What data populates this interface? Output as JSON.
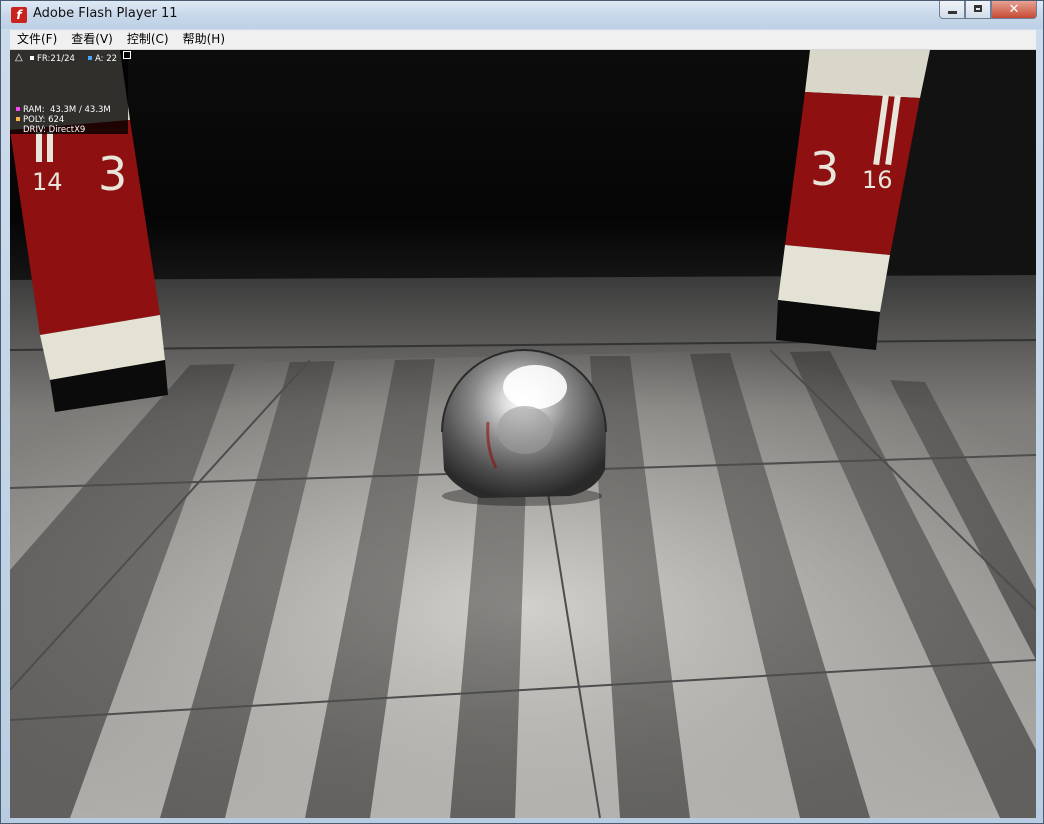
{
  "window": {
    "title": "Adobe Flash Player 11",
    "controls": {
      "minimize": "minimize",
      "maximize": "maximize",
      "close": "✕"
    }
  },
  "menu": {
    "items": [
      "文件(F)",
      "查看(V)",
      "控制(C)",
      "帮助(H)"
    ]
  },
  "stats": {
    "fr_label": "FR:",
    "fr_value": "21/24",
    "a_label": "A:",
    "a_value": "22",
    "ram_label": "RAM:",
    "ram_value": "43.3M / 43.3M",
    "poly_label": "POLY:",
    "poly_value": "624",
    "driv_label": "DRIV:",
    "driv_value": "DirectX9",
    "colors": {
      "fr": "#ffffff",
      "a": "#4aa3ff",
      "ram": "#ff44ff",
      "poly": "#ffb347"
    }
  },
  "scene": {
    "pillar_left_numbers": [
      "14",
      "3"
    ],
    "pillar_right_numbers": [
      "3",
      "16"
    ],
    "colors": {
      "pillar_red": "#8e1010",
      "pillar_band": "#e8e6d8",
      "floor": "#9a9894"
    }
  }
}
